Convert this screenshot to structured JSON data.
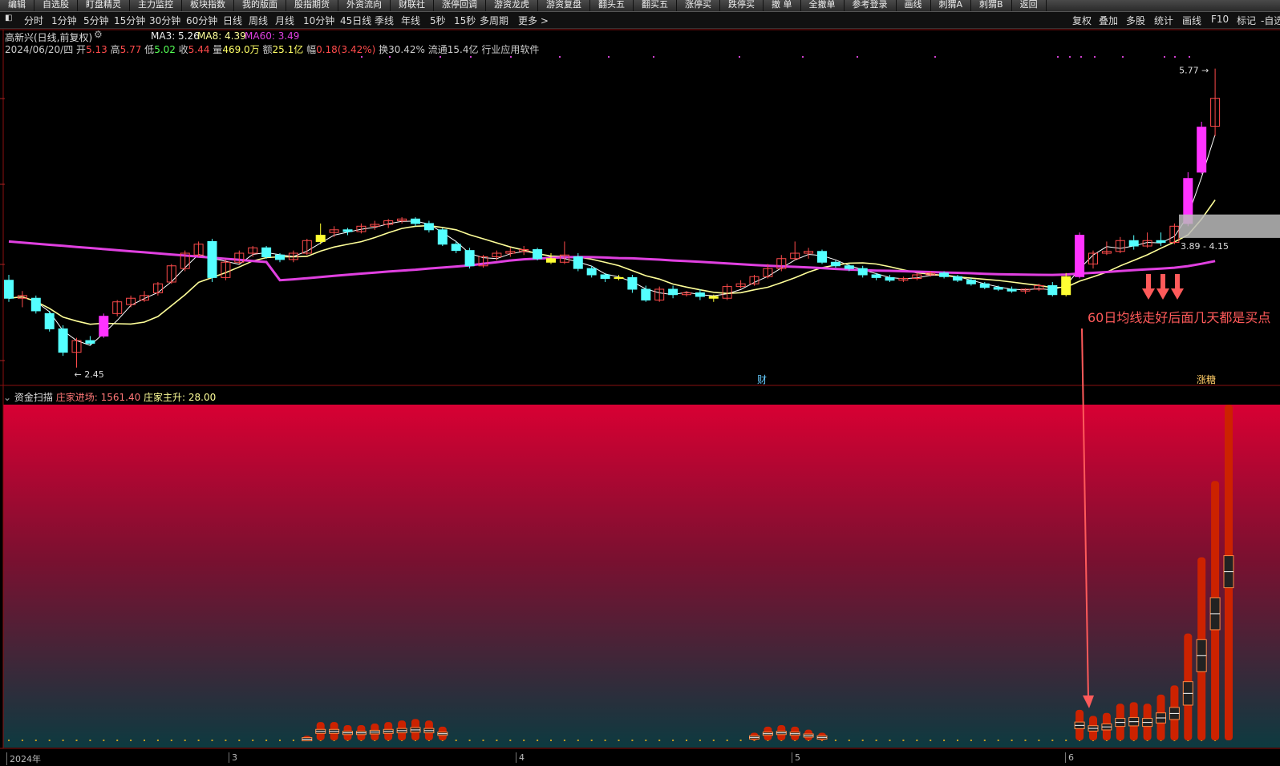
{
  "toolbar": {
    "items": [
      "编辑",
      "自选股",
      "盯盘精灵",
      "主力监控",
      "板块指数",
      "我的版面",
      "股指期货",
      "外资流向",
      "财联社",
      "涨停回调",
      "游资龙虎",
      "游资复盘",
      "翻头五",
      "翻买五",
      "涨停买",
      "跌停买",
      "撤 单",
      "全撤单",
      "参考登录",
      "画线",
      "刺猬A",
      "刺猬B",
      "返回"
    ]
  },
  "periods": {
    "items": [
      "分时",
      "1分钟",
      "5分钟",
      "15分钟",
      "30分钟",
      "60分钟",
      "日线",
      "周线",
      "月线",
      "10分钟",
      "45日线",
      "季线",
      "年线",
      "5秒",
      "15秒",
      "多周期",
      "更多 >"
    ],
    "right_items": [
      "复权",
      "叠加",
      "多股",
      "统计",
      "画线",
      "F10",
      "标记",
      "-自选"
    ]
  },
  "stock": {
    "title": "高新兴(日线,前复权)",
    "ma3_label": "MA3: 5.26",
    "ma8_label": "MA8: 4.39",
    "ma60_label": "MA60: 3.49",
    "date": "2024/06/20/四",
    "open_label": "开",
    "open": "5.13",
    "high_label": "高",
    "high": "5.77",
    "low_label": "低",
    "low": "5.02",
    "close_label": "收",
    "close": "5.44",
    "vol_label": "量",
    "vol": "469.0万",
    "amount_label": "额",
    "amount": "25.1亿",
    "change_label": "幅",
    "change": "0.18(3.42%)",
    "turnover_label": "换",
    "turnover": "30.42%",
    "float_label": "流通",
    "float": "15.4亿",
    "industry": "行业应用软件"
  },
  "indicator": {
    "name": "资金扫描",
    "l1": "庄家进场: 1561.40",
    "l2": "庄家主升: 28.00"
  },
  "colors": {
    "up": "#ff4b4b",
    "down": "#54ffff",
    "ma3": "#ffffff",
    "ma8": "#ffff99",
    "ma60": "#e040e0",
    "magenta_bar": "#ff33ff",
    "yellow_bar": "#ffff33",
    "annot": "#ff5a5a"
  },
  "chart_data": [
    {
      "type": "candlestick",
      "title": "高新兴(日线,前复权)",
      "xlabel": "",
      "ylabel": "",
      "x_ticks": [
        "2024年",
        "3",
        "4",
        "5",
        "6"
      ],
      "low_label": "2.45",
      "high_label": "5.77",
      "zone_label": "3.89 - 4.15",
      "event_labels": [
        "财",
        "涨糖"
      ],
      "annotation": "60日均线走好后面几天都是买点",
      "ohlc": [
        [
          3.42,
          3.48,
          3.18,
          3.22
        ],
        [
          3.22,
          3.3,
          3.12,
          3.25
        ],
        [
          3.22,
          3.25,
          3.05,
          3.08
        ],
        [
          3.05,
          3.08,
          2.85,
          2.88
        ],
        [
          2.88,
          2.92,
          2.58,
          2.62
        ],
        [
          2.62,
          2.78,
          2.45,
          2.75
        ],
        [
          2.75,
          2.8,
          2.7,
          2.72
        ],
        [
          2.8,
          3.05,
          2.78,
          3.02
        ],
        [
          3.05,
          3.2,
          3.02,
          3.18
        ],
        [
          3.15,
          3.25,
          3.12,
          3.22
        ],
        [
          3.2,
          3.3,
          3.18,
          3.25
        ],
        [
          3.28,
          3.4,
          3.25,
          3.38
        ],
        [
          3.4,
          3.6,
          3.38,
          3.58
        ],
        [
          3.55,
          3.75,
          3.52,
          3.72
        ],
        [
          3.7,
          3.85,
          3.68,
          3.82
        ],
        [
          3.85,
          3.88,
          3.4,
          3.45
        ],
        [
          3.45,
          3.65,
          3.42,
          3.62
        ],
        [
          3.62,
          3.75,
          3.6,
          3.72
        ],
        [
          3.72,
          3.8,
          3.68,
          3.78
        ],
        [
          3.78,
          3.8,
          3.66,
          3.68
        ],
        [
          3.7,
          3.72,
          3.62,
          3.65
        ],
        [
          3.65,
          3.75,
          3.62,
          3.72
        ],
        [
          3.72,
          3.88,
          3.7,
          3.86
        ],
        [
          3.85,
          4.05,
          3.82,
          3.92
        ],
        [
          3.95,
          4.02,
          3.9,
          3.98
        ],
        [
          3.98,
          4.0,
          3.92,
          3.96
        ],
        [
          3.96,
          4.05,
          3.94,
          4.02
        ],
        [
          4.02,
          4.08,
          3.98,
          4.04
        ],
        [
          4.04,
          4.1,
          4.0,
          4.08
        ],
        [
          4.08,
          4.12,
          4.05,
          4.1
        ],
        [
          4.1,
          4.12,
          4.02,
          4.05
        ],
        [
          4.05,
          4.08,
          3.95,
          3.98
        ],
        [
          3.98,
          4.0,
          3.8,
          3.82
        ],
        [
          3.82,
          3.85,
          3.72,
          3.75
        ],
        [
          3.75,
          3.78,
          3.55,
          3.58
        ],
        [
          3.58,
          3.7,
          3.56,
          3.68
        ],
        [
          3.68,
          3.75,
          3.64,
          3.72
        ],
        [
          3.72,
          3.78,
          3.68,
          3.74
        ],
        [
          3.74,
          3.8,
          3.7,
          3.76
        ],
        [
          3.76,
          3.78,
          3.64,
          3.66
        ],
        [
          3.66,
          3.72,
          3.6,
          3.62
        ],
        [
          3.62,
          3.85,
          3.6,
          3.7
        ],
        [
          3.68,
          3.72,
          3.52,
          3.55
        ],
        [
          3.55,
          3.58,
          3.45,
          3.48
        ],
        [
          3.48,
          3.5,
          3.4,
          3.44
        ],
        [
          3.44,
          3.48,
          3.42,
          3.45
        ],
        [
          3.45,
          3.48,
          3.28,
          3.32
        ],
        [
          3.32,
          3.36,
          3.18,
          3.2
        ],
        [
          3.2,
          3.35,
          3.18,
          3.32
        ],
        [
          3.32,
          3.36,
          3.22,
          3.26
        ],
        [
          3.26,
          3.3,
          3.24,
          3.28
        ],
        [
          3.28,
          3.32,
          3.2,
          3.24
        ],
        [
          3.24,
          3.26,
          3.18,
          3.22
        ],
        [
          3.22,
          3.38,
          3.2,
          3.35
        ],
        [
          3.35,
          3.42,
          3.33,
          3.38
        ],
        [
          3.38,
          3.48,
          3.36,
          3.46
        ],
        [
          3.46,
          3.6,
          3.44,
          3.55
        ],
        [
          3.55,
          3.7,
          3.52,
          3.66
        ],
        [
          3.66,
          3.85,
          3.64,
          3.72
        ],
        [
          3.72,
          3.78,
          3.66,
          3.74
        ],
        [
          3.74,
          3.76,
          3.6,
          3.62
        ],
        [
          3.62,
          3.64,
          3.56,
          3.58
        ],
        [
          3.58,
          3.6,
          3.52,
          3.55
        ],
        [
          3.55,
          3.58,
          3.45,
          3.48
        ],
        [
          3.48,
          3.5,
          3.42,
          3.45
        ],
        [
          3.45,
          3.48,
          3.4,
          3.42
        ],
        [
          3.42,
          3.46,
          3.4,
          3.44
        ],
        [
          3.44,
          3.5,
          3.42,
          3.48
        ],
        [
          3.48,
          3.52,
          3.46,
          3.5
        ],
        [
          3.5,
          3.52,
          3.44,
          3.46
        ],
        [
          3.46,
          3.48,
          3.4,
          3.42
        ],
        [
          3.42,
          3.45,
          3.36,
          3.38
        ],
        [
          3.38,
          3.4,
          3.32,
          3.34
        ],
        [
          3.34,
          3.36,
          3.3,
          3.32
        ],
        [
          3.32,
          3.35,
          3.28,
          3.3
        ],
        [
          3.3,
          3.33,
          3.27,
          3.32
        ],
        [
          3.32,
          3.38,
          3.3,
          3.36
        ],
        [
          3.36,
          3.4,
          3.24,
          3.26
        ],
        [
          3.26,
          3.5,
          3.24,
          3.46
        ],
        [
          3.46,
          3.95,
          3.44,
          3.92
        ],
        [
          3.6,
          3.75,
          3.55,
          3.72
        ],
        [
          3.72,
          3.85,
          3.7,
          3.74
        ],
        [
          3.74,
          3.9,
          3.72,
          3.86
        ],
        [
          3.86,
          3.92,
          3.76,
          3.8
        ],
        [
          3.8,
          3.95,
          3.78,
          3.86
        ],
        [
          3.86,
          3.95,
          3.8,
          3.84
        ],
        [
          3.84,
          4.05,
          3.82,
          4.02
        ],
        [
          4.05,
          4.62,
          4.02,
          4.55
        ],
        [
          4.62,
          5.18,
          4.6,
          5.12
        ],
        [
          5.13,
          5.77,
          5.02,
          5.44
        ]
      ],
      "series": [
        {
          "name": "MA3"
        },
        {
          "name": "MA8"
        },
        {
          "name": "MA60"
        }
      ]
    },
    {
      "type": "bar",
      "title": "资金扫描",
      "xlabel": "",
      "ylabel": "",
      "series": [
        {
          "name": "庄家进场"
        },
        {
          "name": "庄家主升"
        }
      ],
      "bars": [
        {
          "i": 22,
          "v": 0.3
        },
        {
          "i": 23,
          "v": 1.2
        },
        {
          "i": 24,
          "v": 1.2
        },
        {
          "i": 25,
          "v": 1.0
        },
        {
          "i": 26,
          "v": 1.0
        },
        {
          "i": 27,
          "v": 1.1
        },
        {
          "i": 28,
          "v": 1.2
        },
        {
          "i": 29,
          "v": 1.3
        },
        {
          "i": 30,
          "v": 1.4
        },
        {
          "i": 31,
          "v": 1.3
        },
        {
          "i": 32,
          "v": 0.9
        },
        {
          "i": 55,
          "v": 0.5
        },
        {
          "i": 56,
          "v": 0.9
        },
        {
          "i": 57,
          "v": 1.0
        },
        {
          "i": 58,
          "v": 0.9
        },
        {
          "i": 59,
          "v": 0.7
        },
        {
          "i": 60,
          "v": 0.5
        },
        {
          "i": 79,
          "v": 2.0
        },
        {
          "i": 80,
          "v": 1.6
        },
        {
          "i": 81,
          "v": 1.8
        },
        {
          "i": 82,
          "v": 2.4
        },
        {
          "i": 83,
          "v": 2.5
        },
        {
          "i": 84,
          "v": 2.4
        },
        {
          "i": 85,
          "v": 3.0
        },
        {
          "i": 86,
          "v": 3.6
        },
        {
          "i": 87,
          "v": 7.0
        },
        {
          "i": 88,
          "v": 12.0
        },
        {
          "i": 89,
          "v": 17.0
        },
        {
          "i": 90,
          "v": 22.0
        }
      ]
    }
  ]
}
